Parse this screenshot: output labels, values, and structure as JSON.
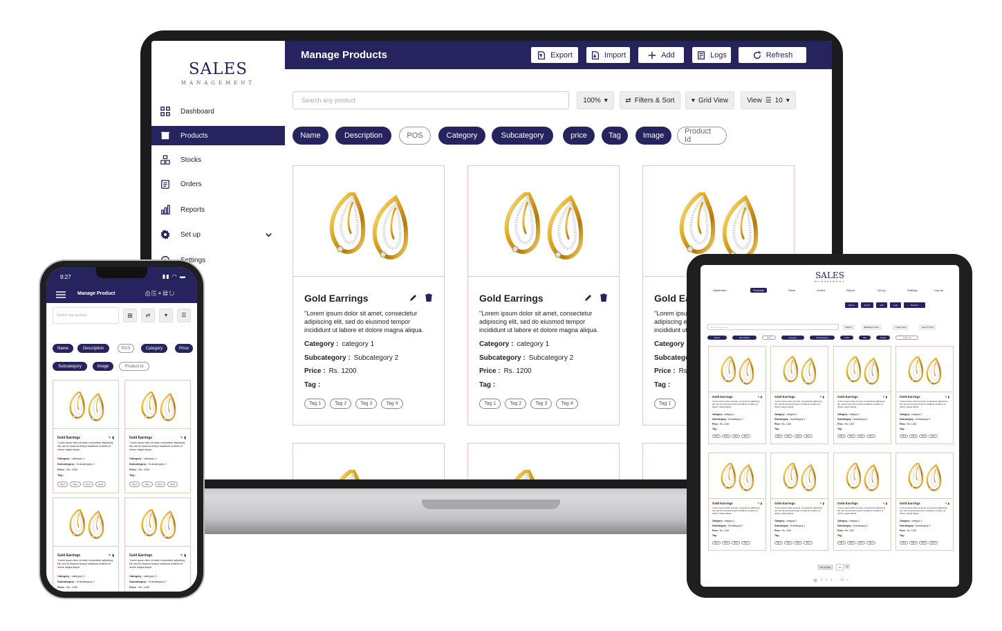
{
  "brand": {
    "name": "SALES",
    "tagline": "MANAGEMENT"
  },
  "laptop": {
    "header_title": "Manage Products",
    "buttons": {
      "export": "Export",
      "import": "Import",
      "add": "Add",
      "logs": "Logs",
      "refresh": "Refresh"
    },
    "sidebar": [
      {
        "label": "Dashboard",
        "icon": "grid-icon"
      },
      {
        "label": "Products",
        "icon": "store-icon",
        "active": true
      },
      {
        "label": "Stocks",
        "icon": "boxes-icon"
      },
      {
        "label": "Orders",
        "icon": "clipboard-icon"
      },
      {
        "label": "Reports",
        "icon": "bar-chart-icon"
      },
      {
        "label": "Set up",
        "icon": "gear-icon"
      },
      {
        "label": "Settings",
        "icon": "settings-icon"
      }
    ],
    "search_placeholder": "Search any product",
    "zoom": "100%",
    "filters_label": "Filters & Sort",
    "grid_view_label": "Grid View",
    "view_label": "View",
    "view_count": "10",
    "chips": [
      {
        "label": "Name",
        "on": true
      },
      {
        "label": "Description",
        "on": true
      },
      {
        "label": "POS",
        "on": false
      },
      {
        "label": "Category",
        "on": true
      },
      {
        "label": "Subcategory",
        "on": true
      },
      {
        "label": "price",
        "on": true
      },
      {
        "label": "Tag",
        "on": true
      },
      {
        "label": "Image",
        "on": true
      },
      {
        "label": "Product Id",
        "on": false
      }
    ]
  },
  "product": {
    "title": "Gold Earrings",
    "description": "\"Lorem ipsum dolor sit amet, consectetur adipiscing elit, sed do eiusmod tempor incididunt ut labore et dolore magna aliqua.",
    "category_label": "Category :",
    "category": "category 1",
    "subcategory_label": "Subcategory :",
    "subcategory": "Subcategory 2",
    "price_label": "Price :",
    "price": "Rs. 1200",
    "tag_label": "Tag :",
    "tags": [
      "Tag 1",
      "Tag 2",
      "Tag 3",
      "Tag 4"
    ]
  },
  "phone": {
    "time": "9:27",
    "title": "Manage Product",
    "search_placeholder": "Search any product",
    "chips": [
      {
        "label": "Name",
        "on": true
      },
      {
        "label": "Description",
        "on": true
      },
      {
        "label": "POS",
        "on": false
      },
      {
        "label": "Category",
        "on": true
      },
      {
        "label": "Price",
        "on": true
      },
      {
        "label": "Subcategory",
        "on": true
      },
      {
        "label": "Image",
        "on": true
      },
      {
        "label": "Product id",
        "on": false
      }
    ]
  },
  "tablet": {
    "nav": [
      "Dashboard",
      "Products",
      "Stock",
      "Orders",
      "Report",
      "Set up",
      "Settings",
      "Log out"
    ],
    "buttons": [
      "Export",
      "Import",
      "Add",
      "Logs",
      "Refresh"
    ],
    "search_placeholder": "Search any product",
    "zoom": "100%",
    "filters_label": "Filters & Sort",
    "grid_view_label": "Grid View",
    "view_label": "View",
    "view_count": "10",
    "chips": [
      "Name",
      "Description",
      "POS",
      "Category",
      "Subcategory",
      "price",
      "Tag",
      "Image",
      "Order Id"
    ],
    "goto_label": "Go to Page",
    "goto_value": "10",
    "pages": [
      "1",
      "2",
      "3",
      "4",
      "...",
      "10",
      ">"
    ],
    "subcategory_variant": "Subcategory 3"
  },
  "colors": {
    "primary": "#26235f",
    "card_border": "#e3c9b6",
    "gold": "#d9a21b"
  }
}
